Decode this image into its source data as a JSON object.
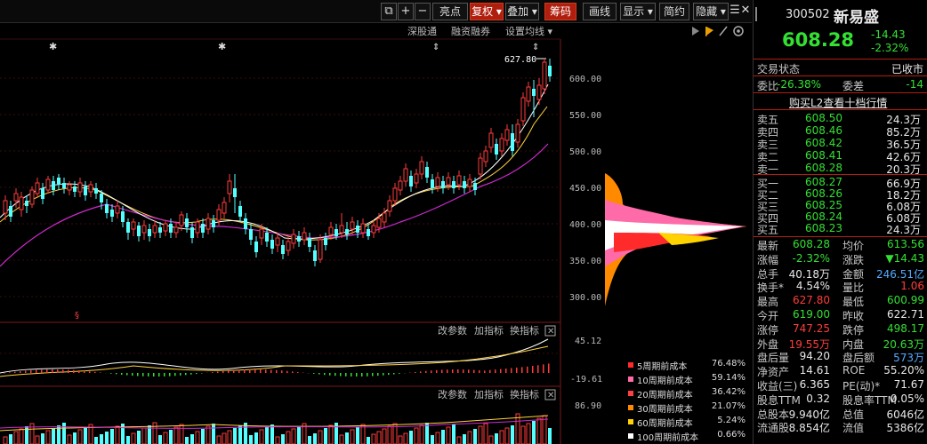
{
  "toolbar": {
    "buttons": [
      {
        "id": "copy",
        "label": "⧉"
      },
      {
        "id": "plus",
        "label": "+"
      },
      {
        "id": "minus",
        "label": "−"
      },
      {
        "id": "highlight",
        "label": "亮点"
      },
      {
        "id": "fuquan",
        "label": "复权 ▾"
      },
      {
        "id": "diejia",
        "label": "叠加 ▾"
      },
      {
        "id": "chouma",
        "label": "筹码"
      },
      {
        "id": "huaxian",
        "label": "画线"
      },
      {
        "id": "xianshi",
        "label": "显示 ▾"
      },
      {
        "id": "jianyue",
        "label": "简约"
      },
      {
        "id": "yincang",
        "label": "隐藏 ▾"
      },
      {
        "id": "prev",
        "label": "☰"
      },
      {
        "id": "close",
        "label": "✕"
      }
    ]
  },
  "subbar": {
    "shengutong": "深股通",
    "rongzi": "融资融券",
    "settings": "设置均线 ▾",
    "price_label": "627.80"
  },
  "price_axis": {
    "ticks": [
      "600.00",
      "550.00",
      "500.00",
      "450.00",
      "400.00",
      "350.00",
      "300.00"
    ]
  },
  "macd": {
    "params": "改参数",
    "add": "加指标",
    "switch": "换指标",
    "top": "45.12",
    "bottom": "-19.61"
  },
  "vol": {
    "params": "改参数",
    "add": "加指标",
    "switch": "换指标",
    "top": "86.90"
  },
  "legend": [
    {
      "label": "5周期前成本",
      "value": "76.48%",
      "color": "#ff2a2a"
    },
    {
      "label": "10周期前成本",
      "value": "59.14%",
      "color": "#ff6aa8"
    },
    {
      "label": "20周期前成本",
      "value": "36.42%",
      "color": "#ff4040"
    },
    {
      "label": "30周期前成本",
      "value": "21.07%",
      "color": "#ff8a00"
    },
    {
      "label": "60周期前成本",
      "value": "5.24%",
      "color": "#ffd200"
    },
    {
      "label": "100周期前成本",
      "value": "0.66%",
      "color": "#ffffff"
    }
  ],
  "stock": {
    "code": "300502",
    "name": "新易盛",
    "price": "608.28",
    "change": "-14.43",
    "change_pct": "-2.32%",
    "status_label": "交易状态",
    "status_value": "已收市",
    "weibi_label": "委比",
    "weibi_value": "-26.38%",
    "weicha_label": "委差",
    "weicha_value": "-14",
    "l2_link": "购买L2查看十档行情"
  },
  "asks": [
    {
      "label": "卖五",
      "price": "608.50",
      "vol": "24.3万"
    },
    {
      "label": "卖四",
      "price": "608.46",
      "vol": "85.2万"
    },
    {
      "label": "卖三",
      "price": "608.42",
      "vol": "36.5万"
    },
    {
      "label": "卖二",
      "price": "608.41",
      "vol": "42.6万"
    },
    {
      "label": "卖一",
      "price": "608.28",
      "vol": "20.3万"
    }
  ],
  "bids": [
    {
      "label": "买一",
      "price": "608.27",
      "vol": "66.9万"
    },
    {
      "label": "买二",
      "price": "608.26",
      "vol": "18.2万"
    },
    {
      "label": "买三",
      "price": "608.25",
      "vol": "6.08万"
    },
    {
      "label": "买四",
      "price": "608.24",
      "vol": "6.08万"
    },
    {
      "label": "买五",
      "price": "608.23",
      "vol": "24.3万"
    }
  ],
  "stats": [
    {
      "l1": "最新",
      "v1": "608.28",
      "c1": "green",
      "l2": "均价",
      "v2": "613.56",
      "c2": "green"
    },
    {
      "l1": "涨幅",
      "v1": "-2.32%",
      "c1": "green",
      "l2": "涨跌",
      "v2": "▼14.43",
      "c2": "green"
    },
    {
      "l1": "总手",
      "v1": "40.18万",
      "c1": "white",
      "l2": "金额",
      "v2": "246.51亿",
      "c2": "blue"
    },
    {
      "l1": "换手*",
      "v1": "4.54%",
      "c1": "white",
      "l2": "量比",
      "v2": "1.06",
      "c2": "red"
    },
    {
      "l1": "最高",
      "v1": "627.80",
      "c1": "red",
      "l2": "最低",
      "v2": "600.99",
      "c2": "green"
    },
    {
      "l1": "今开",
      "v1": "619.00",
      "c1": "green",
      "l2": "昨收",
      "v2": "622.71",
      "c2": "white"
    },
    {
      "l1": "涨停",
      "v1": "747.25",
      "c1": "red",
      "l2": "跌停",
      "v2": "498.17",
      "c2": "green"
    },
    {
      "l1": "外盘",
      "v1": "19.55万",
      "c1": "red",
      "l2": "内盘",
      "v2": "20.63万",
      "c2": "green"
    },
    {
      "l1": "盘后量",
      "v1": "94.20",
      "c1": "white",
      "l2": "盘后额",
      "v2": "573万",
      "c2": "blue"
    },
    {
      "l1": "净资产",
      "v1": "14.61",
      "c1": "white",
      "l2": "ROE",
      "v2": "55.20%",
      "c2": "white"
    },
    {
      "l1": "收益(三)",
      "v1": "6.365",
      "c1": "white",
      "l2": "PE(动)*",
      "v2": "71.67",
      "c2": "white"
    },
    {
      "l1": "股息TTM",
      "v1": "0.32",
      "c1": "white",
      "l2": "股息率TTM",
      "v2": "0.05%",
      "c2": "white"
    },
    {
      "l1": "总股本",
      "v1": "9.940亿",
      "c1": "white",
      "l2": "总值",
      "v2": "6046亿",
      "c2": "white"
    },
    {
      "l1": "流通股",
      "v1": "8.854亿",
      "c1": "white",
      "l2": "流值",
      "v2": "5386亿",
      "c2": "white"
    }
  ]
}
